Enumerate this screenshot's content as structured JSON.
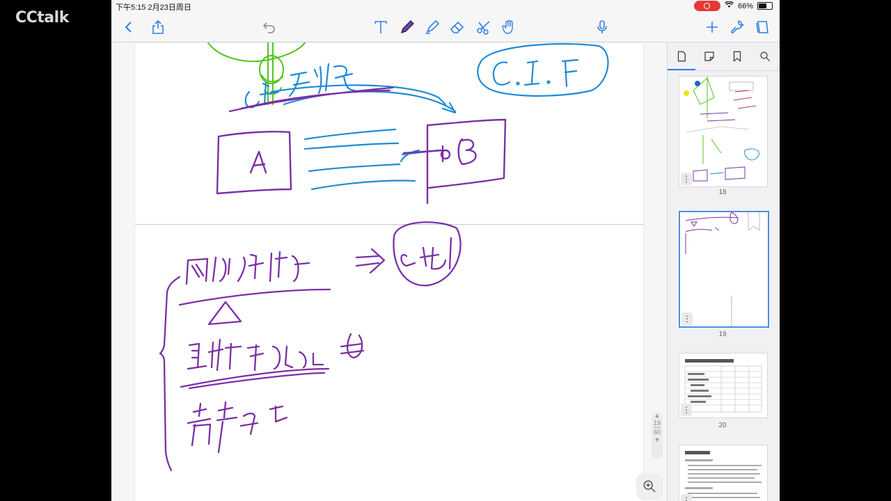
{
  "cctalk": {
    "logo": "CCtalk"
  },
  "status_bar": {
    "time_date": "下午5:15   2月23日周日",
    "battery_text": "66%",
    "battery_level": 0.66
  },
  "toolbar": {
    "left": [
      "chevron-left-icon",
      "share-icon"
    ],
    "center": [
      "undo-icon",
      "text-tool-icon",
      "pen-tool-icon",
      "highlighter-icon",
      "eraser-icon",
      "lasso-icon",
      "hand-icon",
      "microphone-icon"
    ],
    "right": [
      "add-icon",
      "wrench-icon",
      "pages-icon"
    ],
    "accent_color": "#2f7fe6"
  },
  "page_indicator": {
    "current": "19",
    "total": "60"
  },
  "sidebar": {
    "tabs": [
      "pages-tab",
      "bookmark-outline-tab",
      "bookmark-tab",
      "search-tab"
    ],
    "thumbnails": [
      {
        "label": "18"
      },
      {
        "label": "19"
      },
      {
        "label": "20"
      }
    ]
  },
  "colors": {
    "ink_blue": "#1e8ad6",
    "ink_purple": "#7b2fa6",
    "ink_green": "#52c41a"
  }
}
